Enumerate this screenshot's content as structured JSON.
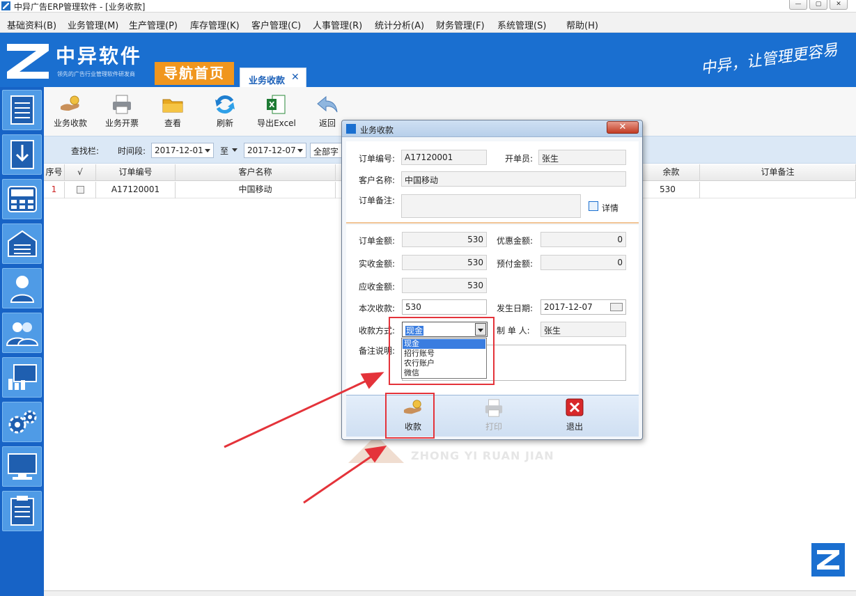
{
  "window": {
    "title": "中异广告ERP管理软件 - [业务收款]"
  },
  "menubar": [
    "基础资料(B)",
    "业务管理(M)",
    "生产管理(P)",
    "库存管理(K)",
    "客户管理(C)",
    "人事管理(R)",
    "统计分析(A)",
    "财务管理(F)",
    "系统管理(S)",
    "帮助(H)"
  ],
  "header": {
    "logo_text": "中异软件",
    "logo_sub": "领先的广告行业管理软件研发商",
    "home_tab": "导航首页",
    "active_tab": "业务收款",
    "slogan": "中异，让管理更容易"
  },
  "toolbar": [
    "业务收款",
    "业务开票",
    "查看",
    "刷新",
    "导出Excel",
    "返回"
  ],
  "search": {
    "label": "查找栏:",
    "period_label": "时间段:",
    "date_from": "2017-12-01",
    "to_label": "至",
    "date_to": "2017-12-07",
    "field_select": "全部字段"
  },
  "grid": {
    "headers": [
      "序号",
      "√",
      "订单编号",
      "客户名称",
      "余款",
      "订单备注"
    ],
    "rows": [
      {
        "index": "1",
        "order_no": "A17120001",
        "customer": "中国移动",
        "balance": "530",
        "remark": ""
      }
    ]
  },
  "dialog": {
    "title": "业务收款",
    "order_no_label": "订单编号:",
    "order_no": "A17120001",
    "issuer_label": "开单员:",
    "issuer": "张生",
    "customer_label": "客户名称:",
    "customer": "中国移动",
    "order_remark_label": "订单备注:",
    "details_link": "详情",
    "order_amount_label": "订单金额:",
    "order_amount": "530",
    "discount_label": "优惠金额:",
    "discount": "0",
    "received_label": "实收金额:",
    "received": "530",
    "prepaid_label": "预付金额:",
    "prepaid": "0",
    "receivable_label": "应收金额:",
    "receivable": "530",
    "this_payment_label": "本次收款:",
    "this_payment": "530",
    "date_label": "发生日期:",
    "date": "2017-12-07",
    "method_label": "收款方式:",
    "method": "现金",
    "maker_label": "制 单 人:",
    "maker": "张生",
    "note_label": "备注说明:",
    "method_options": [
      "现金",
      "招行账号",
      "农行账户",
      "微信"
    ],
    "buttons": {
      "collect": "收款",
      "print": "打印",
      "exit": "退出"
    }
  },
  "watermark_en": "ZHONG YI RUAN JIAN",
  "colors": {
    "brand_blue": "#1a6fd0",
    "orange": "#f0961e",
    "highlight_red": "#e4333a"
  }
}
